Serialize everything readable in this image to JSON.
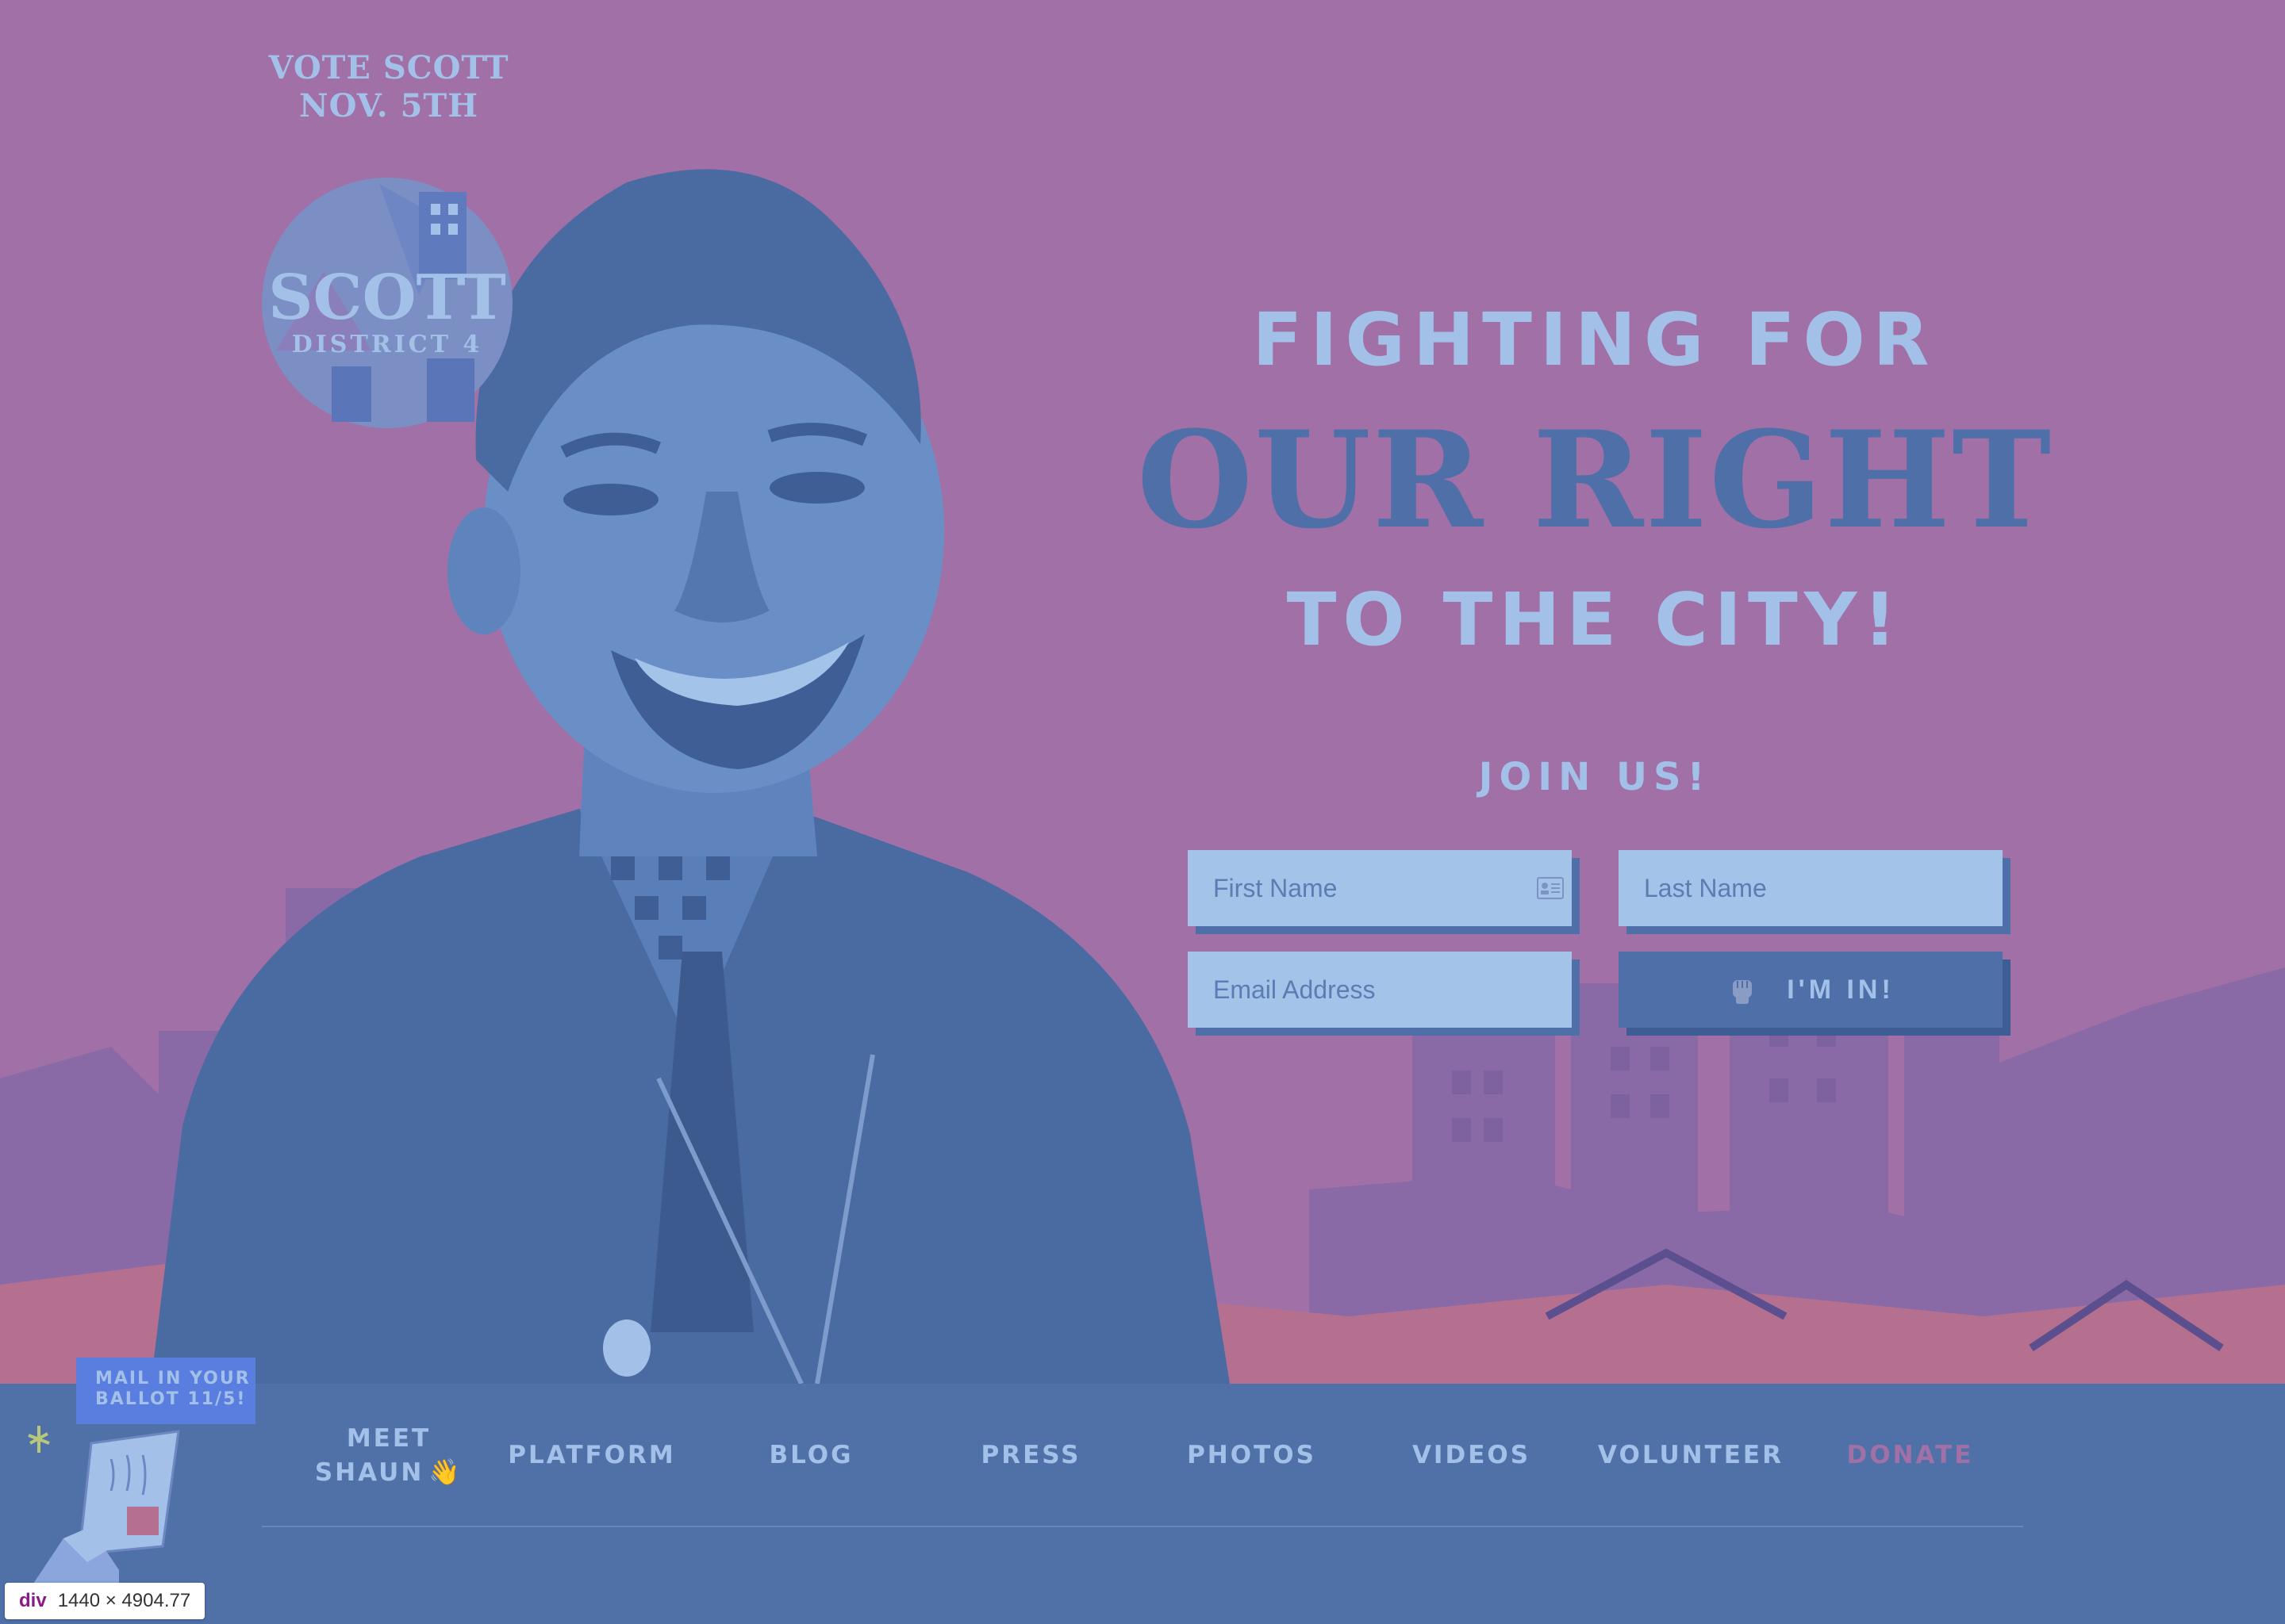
{
  "brand": {
    "vote_line1": "VOTE SCOTT",
    "vote_line2": "NOV. 5TH",
    "logo_name": "SCOTT",
    "logo_district": "DISTRICT 4"
  },
  "hero": {
    "line1": "FIGHTING FOR",
    "line2": "OUR RIGHT",
    "line3": "TO THE CITY!"
  },
  "signup": {
    "title": "JOIN US!",
    "first_name_placeholder": "First Name",
    "last_name_placeholder": "Last Name",
    "email_placeholder": "Email Address",
    "submit_label": "I'M IN!",
    "submit_icon": "raised-fist-icon",
    "first_name_icon": "contact-card-icon"
  },
  "nav": {
    "meet_line1": "MEET",
    "meet_line2": "SHAUN",
    "meet_icon": "👋",
    "platform": "PLATFORM",
    "blog": "BLOG",
    "press": "PRESS",
    "photos": "PHOTOS",
    "videos": "VIDEOS",
    "volunteer": "VOLUNTEER",
    "donate": "DONATE"
  },
  "ballot_badge": {
    "line1": "MAIL IN YOUR",
    "line2": "BALLOT 11/5!"
  },
  "inspector": {
    "tag": "div",
    "size": "1440 × 4904.77"
  },
  "colors": {
    "background": "#a070a6",
    "primary_blue": "#4f6fa8",
    "light_blue": "#a3c1e8",
    "nav_bar": "#4f71a8",
    "badge_blue": "#5a7de0",
    "donate_accent": "#a070a6"
  }
}
